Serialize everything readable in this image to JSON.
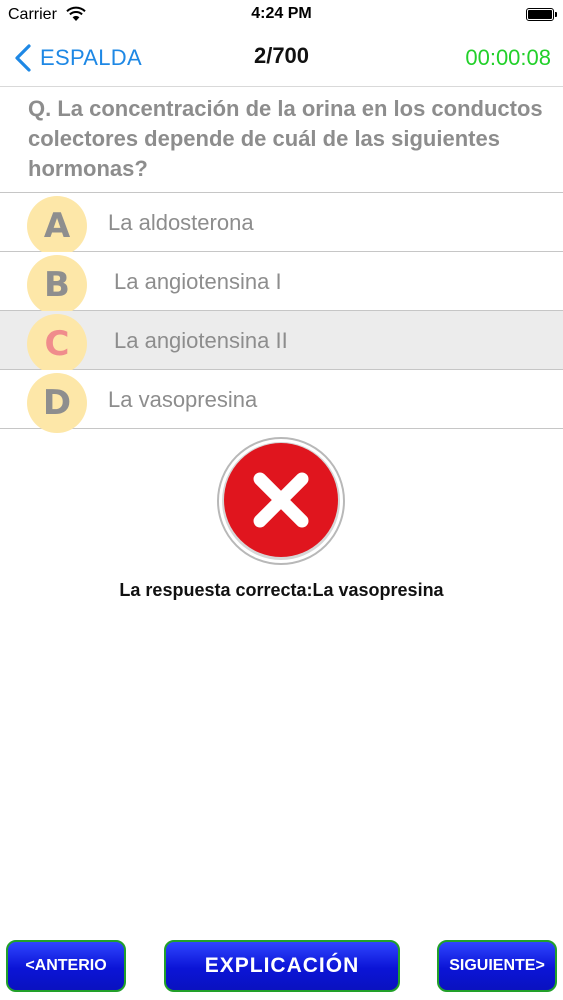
{
  "status_bar": {
    "carrier": "Carrier",
    "time": "4:24 PM"
  },
  "nav": {
    "back_label": "ESPALDA",
    "progress": "2/700",
    "timer": "00:00:08"
  },
  "question": {
    "text": "Q. La concentración de la orina en los conductos colectores depende de cuál de las siguientes hormonas?"
  },
  "options": [
    {
      "letter": "A",
      "label": "La aldosterona"
    },
    {
      "letter": "B",
      "label": "La angiotensina I"
    },
    {
      "letter": "C",
      "label": "La angiotensina II"
    },
    {
      "letter": "D",
      "label": "La vasopresina"
    }
  ],
  "result": {
    "icon": "wrong-x-icon",
    "text": "La respuesta correcta:La vasopresina"
  },
  "buttons": {
    "prev": "<ANTERIO",
    "explain": "EXPLICACIÓN",
    "next": "SIGUIENTE>"
  },
  "colors": {
    "accent": "#1e88e5",
    "timer": "#22d02a",
    "badge": "#fde7a8",
    "wrong": "#e0151e",
    "button": "#0b14d6"
  }
}
